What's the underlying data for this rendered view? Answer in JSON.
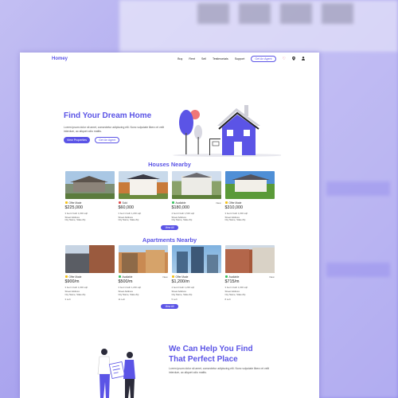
{
  "brand": {
    "name": "Homey",
    "accent": "#5b54e6"
  },
  "nav": {
    "links": [
      "Buy",
      "Rent",
      "Sell",
      "Testimonials",
      "Support"
    ],
    "cta": "Get An Agent",
    "icons": [
      "heart-icon",
      "location-pin-icon",
      "user-icon"
    ]
  },
  "hero": {
    "title": "Find Your Dream Home",
    "text": "Lorem ipsum dolor sit amet, consectetur adipiscing elit. Nunc vulputate libero et velit interdum, ac aliquet odio mattis.",
    "primary_button": "View Properties",
    "secondary_button": "Get An Agent"
  },
  "houses": {
    "title": "Houses Nearby",
    "view_all": "View All",
    "items": [
      {
        "status": "Offer Made",
        "status_color": "#f3c21b",
        "new": "",
        "price": "$225,000",
        "specs": "3 bed   2 bath   1,000 sqft",
        "address1": "Street Address",
        "address2": "City Name, State Zip"
      },
      {
        "status": "Sold",
        "status_color": "#e04a4a",
        "new": "",
        "price": "$60,000",
        "specs": "3 bed   1 bath   1,200 sqft",
        "address1": "Street Address",
        "address2": "City Name, State Zip"
      },
      {
        "status": "Available",
        "status_color": "#3cc463",
        "new": "New",
        "price": "$180,000",
        "specs": "4 bed   2 bath   1,500 sqft",
        "address1": "Street Address",
        "address2": "City Name, State Zip"
      },
      {
        "status": "Offer Made",
        "status_color": "#f3c21b",
        "new": "",
        "price": "$310,000",
        "specs": "3 bed   2 bath   1,000 sqft",
        "address1": "Street Address",
        "address2": "City Name, State Zip"
      }
    ]
  },
  "apartments": {
    "title": "Apartments Nearby",
    "view_all": "View All",
    "items": [
      {
        "status": "Offer Made",
        "status_color": "#f3c21b",
        "new": "",
        "price": "$900/m",
        "specs": "3 bed   1 bath   1,000 sqft",
        "address1": "Street Address",
        "address2": "City Name, State Zip",
        "floor": "3 Left"
      },
      {
        "status": "Available",
        "status_color": "#3cc463",
        "new": "New",
        "price": "$500/m",
        "specs": "3 bed   1 bath   1,200 sqft",
        "address1": "Street Address",
        "address2": "City Name, State Zip",
        "floor": "11 Left"
      },
      {
        "status": "Offer Made",
        "status_color": "#f3c21b",
        "new": "",
        "price": "$1,200/m",
        "specs": "4 bed   2 bath   1,200 sqft",
        "address1": "Street Address",
        "address2": "City Name, State Zip",
        "floor": "5 Left"
      },
      {
        "status": "Available",
        "status_color": "#3cc463",
        "new": "New",
        "price": "$715/m",
        "specs": "3 bed   1 bath   1,000 sqft",
        "address1": "Street Address",
        "address2": "City Name, State Zip",
        "floor": "8 Left"
      }
    ]
  },
  "help": {
    "title_line1": "We Can Help You Find",
    "title_line2": "That Perfect Place",
    "text": "Lorem ipsum dolor sit amet, consectetur adipiscing elit. Nunc vulputate libero et velit interdum, ac aliquet odio mattis."
  }
}
